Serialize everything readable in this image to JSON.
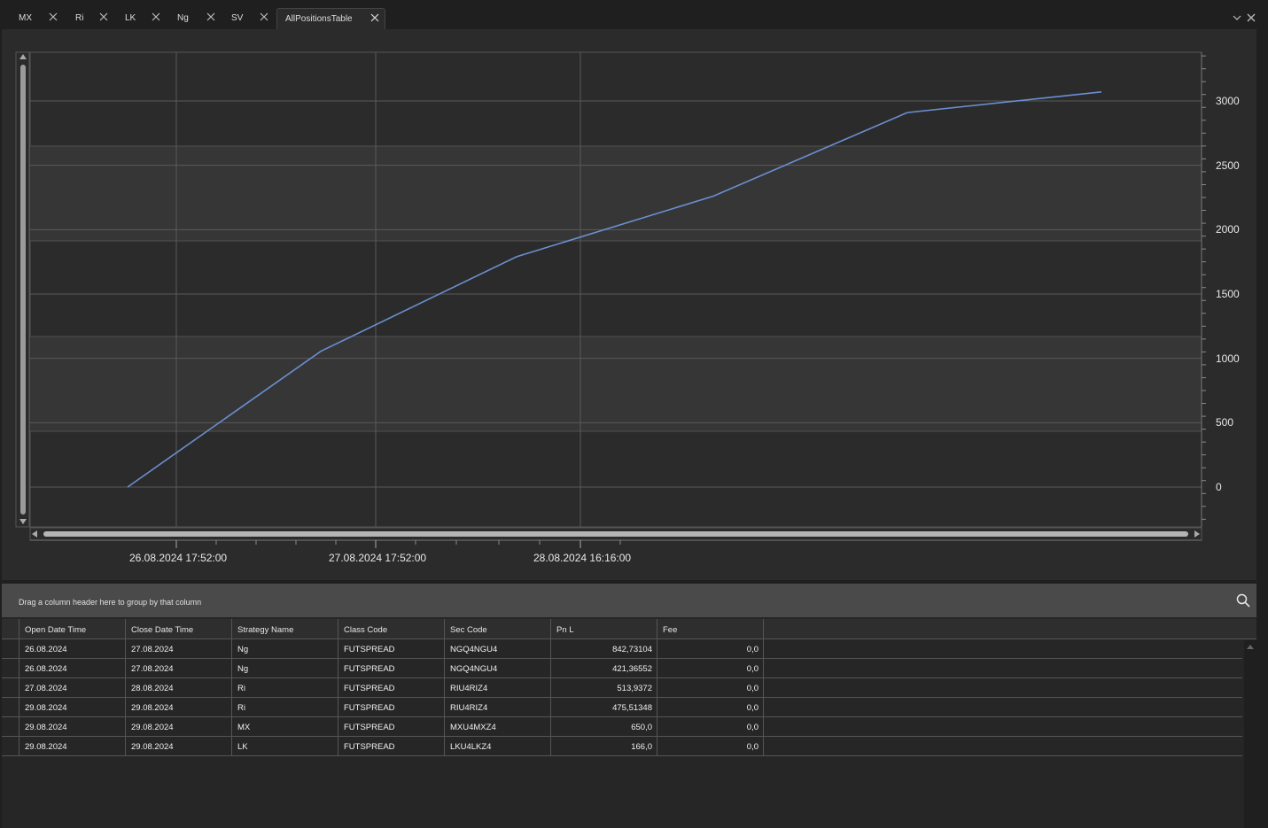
{
  "tabs": [
    {
      "label": "MX"
    },
    {
      "label": "Ri"
    },
    {
      "label": "LK"
    },
    {
      "label": "Ng"
    },
    {
      "label": "SV"
    },
    {
      "label": "AllPositionsTable",
      "active": true
    }
  ],
  "chart_data": {
    "type": "line",
    "title": "",
    "xlabel": "",
    "ylabel": "",
    "x_tick_labels": [
      "26.08.2024 17:52:00",
      "27.08.2024 17:52:00",
      "28.08.2024 16:16:00"
    ],
    "y_ticks": [
      0,
      500,
      1000,
      1500,
      2000,
      2500,
      3000
    ],
    "ylim": [
      -300,
      3380
    ],
    "series": [
      {
        "values": [
          0,
          1055,
          1790,
          2260,
          2910,
          3070
        ]
      }
    ],
    "color": "#6a8fd0",
    "grid": true,
    "y_axis_side": "right"
  },
  "grid": {
    "group_panel_text": "Drag a column header here to group by that column",
    "columns": [
      "Open Date Time",
      "Close Date Time",
      "Strategy Name",
      "Class Code",
      "Sec Code",
      "Pn L",
      "Fee"
    ],
    "rows": [
      [
        "26.08.2024",
        "27.08.2024",
        "Ng",
        "FUTSPREAD",
        "NGQ4NGU4",
        "842,73104",
        "0,0"
      ],
      [
        "26.08.2024",
        "27.08.2024",
        "Ng",
        "FUTSPREAD",
        "NGQ4NGU4",
        "421,36552",
        "0,0"
      ],
      [
        "27.08.2024",
        "28.08.2024",
        "Ri",
        "FUTSPREAD",
        "RIU4RIZ4",
        "513,9372",
        "0,0"
      ],
      [
        "29.08.2024",
        "29.08.2024",
        "Ri",
        "FUTSPREAD",
        "RIU4RIZ4",
        "475,51348",
        "0,0"
      ],
      [
        "29.08.2024",
        "29.08.2024",
        "MX",
        "FUTSPREAD",
        "MXU4MXZ4",
        "650,0",
        "0,0"
      ],
      [
        "29.08.2024",
        "29.08.2024",
        "LK",
        "FUTSPREAD",
        "LKU4LKZ4",
        "166,0",
        "0,0"
      ]
    ]
  }
}
